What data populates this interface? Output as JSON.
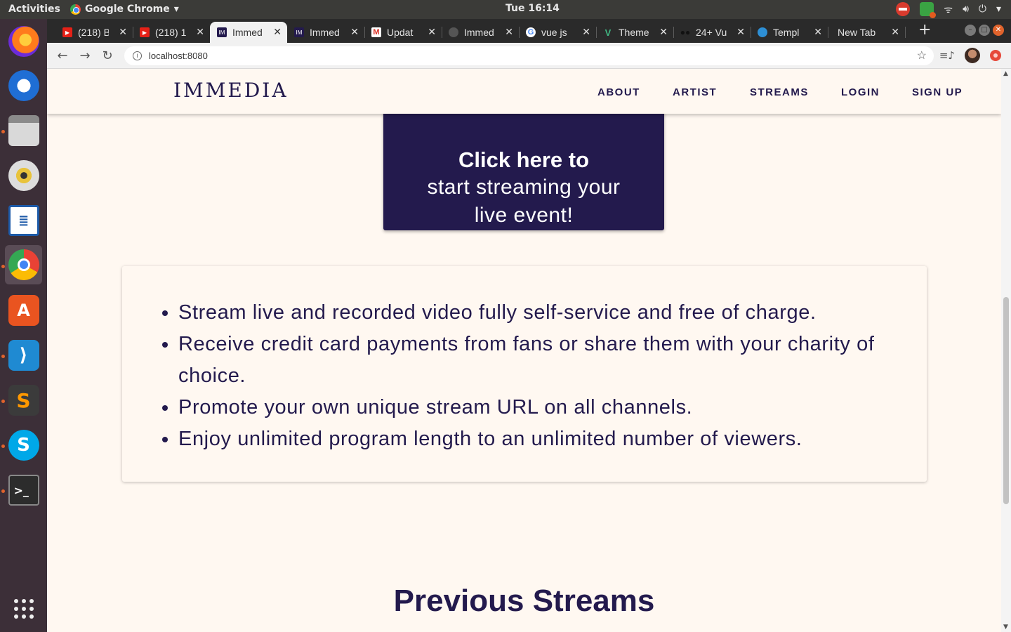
{
  "system": {
    "activities": "Activities",
    "app_menu": "Google Chrome",
    "clock": "Tue 16:14"
  },
  "browser": {
    "tabs": [
      {
        "title": "(218) B",
        "favicon": "youtube-icon",
        "color": "#e62117"
      },
      {
        "title": "(218) 1",
        "favicon": "youtube-icon",
        "color": "#e62117"
      },
      {
        "title": "Immed",
        "favicon": "immedia-icon",
        "color": "#231a4d",
        "active": true
      },
      {
        "title": "Immed",
        "favicon": "immedia-icon",
        "color": "#231a4d"
      },
      {
        "title": "Updat",
        "favicon": "gmail-icon",
        "color": "#d93025"
      },
      {
        "title": "Immed",
        "favicon": "github-icon",
        "color": "#555555"
      },
      {
        "title": "vue js",
        "favicon": "google-icon",
        "color": "#4285f4"
      },
      {
        "title": "Theme",
        "favicon": "vuetify-icon",
        "color": "#41b883"
      },
      {
        "title": "24+ Vu",
        "favicon": "mask-icon",
        "color": "#111111"
      },
      {
        "title": "Templ",
        "favicon": "globe-icon",
        "color": "#2d8fd5"
      },
      {
        "title": "New Tab",
        "favicon": "",
        "color": ""
      }
    ],
    "url": "localhost:8080"
  },
  "site": {
    "logo": "IMMEDIA",
    "nav": [
      "ABOUT",
      "ARTIST",
      "STREAMS",
      "LOGIN",
      "SIGN UP"
    ],
    "cta": {
      "bold": "Click here to",
      "line2": "start streaming your",
      "line3": "live event!"
    },
    "features": [
      "Stream live and recorded video fully self-service and free of charge.",
      "Receive credit card payments from fans or share them with your charity of choice.",
      "Promote your own unique stream URL on all channels.",
      "Enjoy unlimited program length to an unlimited number of viewers."
    ],
    "previous_streams_title": "Previous Streams"
  },
  "colors": {
    "brand": "#231a4d",
    "page_bg": "#fff8f1"
  }
}
